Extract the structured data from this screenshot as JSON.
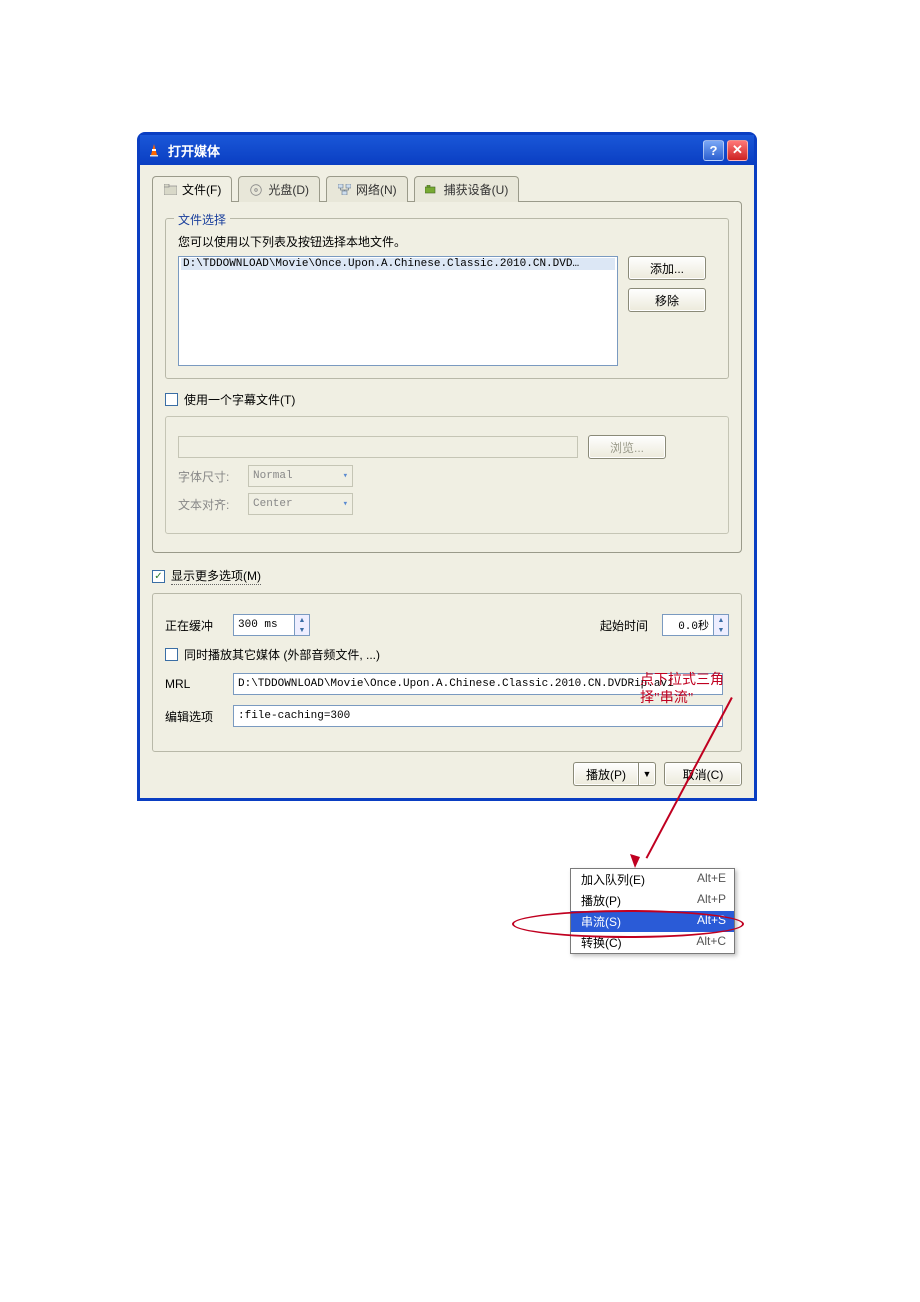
{
  "window": {
    "title": "打开媒体"
  },
  "tabs": {
    "file": "文件(F)",
    "disc": "光盘(D)",
    "network": "网络(N)",
    "capture": "捕获设备(U)"
  },
  "file_section": {
    "legend": "文件选择",
    "desc": "您可以使用以下列表及按钮选择本地文件。",
    "item_truncated": "D:\\TDDOWNLOAD\\Movie\\Once.Upon.A.Chinese.Classic.2010.CN.DVD…",
    "add_btn": "添加...",
    "remove_btn": "移除"
  },
  "subtitle": {
    "checkbox_label": "使用一个字幕文件(T)",
    "browse_btn": "浏览...",
    "font_size_label": "字体尺寸:",
    "font_size_value": "Normal",
    "align_label": "文本对齐:",
    "align_value": "Center"
  },
  "more_options": {
    "checkbox_label": "显示更多选项(M)",
    "checked": true,
    "caching_label": "正在缓冲",
    "caching_value": "300 ms",
    "start_time_label": "起始时间",
    "start_time_value": "0.0秒",
    "play_sync_label": "同时播放其它媒体 (外部音频文件, ...)",
    "mrl_label": "MRL",
    "mrl_value": "D:\\TDDOWNLOAD\\Movie\\Once.Upon.A.Chinese.Classic.2010.CN.DVDRip.avi",
    "edit_opts_label": "编辑选项",
    "edit_opts_value": ":file-caching=300"
  },
  "footer": {
    "play_btn": "播放(P)",
    "cancel_btn": "取消(C)"
  },
  "menu": {
    "items": [
      {
        "label": "加入队列(E)",
        "shortcut": "Alt+E"
      },
      {
        "label": "播放(P)",
        "shortcut": "Alt+P"
      },
      {
        "label": "串流(S)",
        "shortcut": "Alt+S",
        "selected": true
      },
      {
        "label": "转换(C)",
        "shortcut": "Alt+C"
      }
    ]
  },
  "annotation": {
    "line1": "点下拉式三角",
    "line2": "择\"串流\""
  }
}
